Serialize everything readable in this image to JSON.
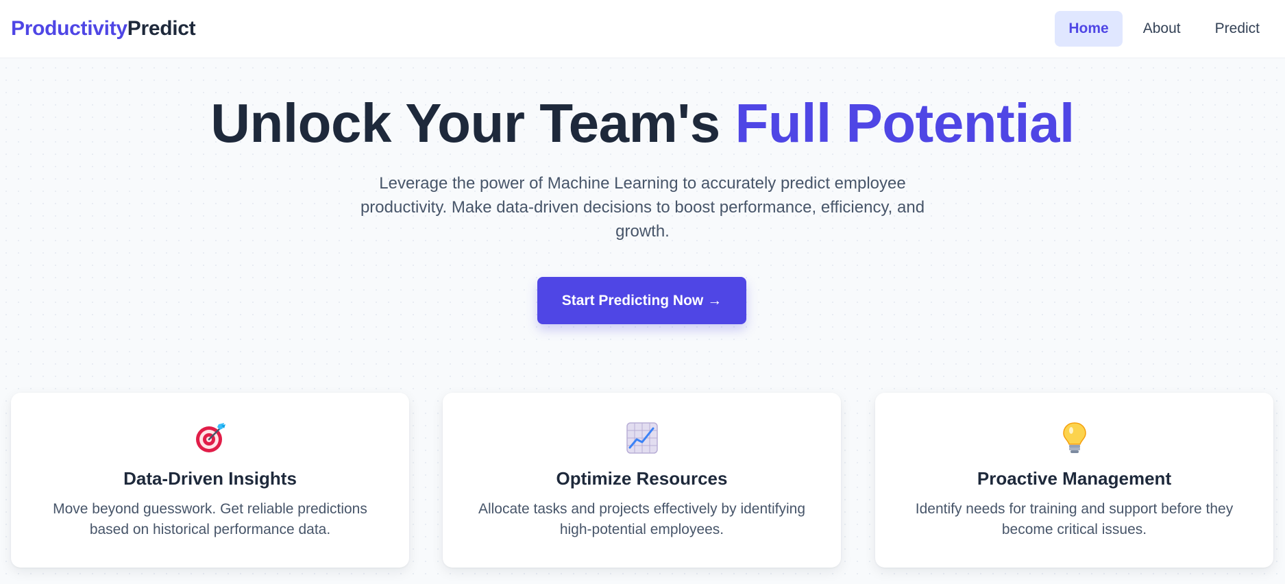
{
  "header": {
    "logo_part1": "Productivity",
    "logo_part2": "Predict",
    "nav": [
      {
        "label": "Home",
        "active": true
      },
      {
        "label": "About",
        "active": false
      },
      {
        "label": "Predict",
        "active": false
      }
    ]
  },
  "hero": {
    "title_main": "Unlock Your Team's",
    "title_accent": "Full Potential",
    "subtitle": "Leverage the power of Machine Learning to accurately predict employee productivity. Make data-driven decisions to boost performance, efficiency, and growth.",
    "cta_label": "Start Predicting Now",
    "cta_arrow": "→"
  },
  "features": [
    {
      "icon": "target-icon",
      "title": "Data-Driven Insights",
      "description": "Move beyond guesswork. Get reliable predictions based on historical performance data."
    },
    {
      "icon": "chart-increasing-icon",
      "title": "Optimize Resources",
      "description": "Allocate tasks and projects effectively by identifying high-potential employees."
    },
    {
      "icon": "lightbulb-icon",
      "title": "Proactive Management",
      "description": "Identify needs for training and support before they become critical issues."
    }
  ],
  "colors": {
    "accent": "#4f46e5",
    "accent_light": "#e0e7ff",
    "text_dark": "#1e293b",
    "text_muted": "#475569",
    "background": "#f8fafc"
  }
}
